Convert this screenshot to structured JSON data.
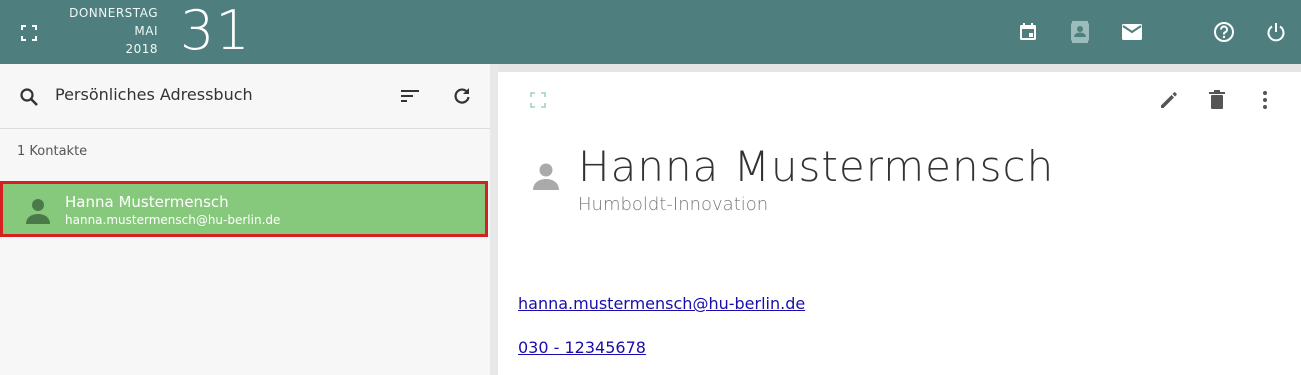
{
  "header": {
    "weekday": "DONNERSTAG",
    "month": "MAI",
    "year": "2018",
    "day": "31",
    "icons": [
      "fullscreen-icon",
      "calendar-icon",
      "contacts-icon",
      "mail-icon",
      "help-icon",
      "power-icon"
    ]
  },
  "addressbook": {
    "title": "Persönliches Adressbuch",
    "count_label": "1 Kontakte",
    "contacts": [
      {
        "name": "Hanna Mustermensch",
        "email": "hanna.mustermensch@hu-berlin.de"
      }
    ]
  },
  "detail": {
    "name": "Hanna Mustermensch",
    "organization": "Humboldt-Innovation",
    "email": "hanna.mustermensch@hu-berlin.de",
    "phone": "030 - 12345678"
  },
  "colors": {
    "header_bg": "#4e7f7e",
    "selected_bg": "#87c97c",
    "selection_border": "#d42020",
    "link": "#1a0dab"
  }
}
